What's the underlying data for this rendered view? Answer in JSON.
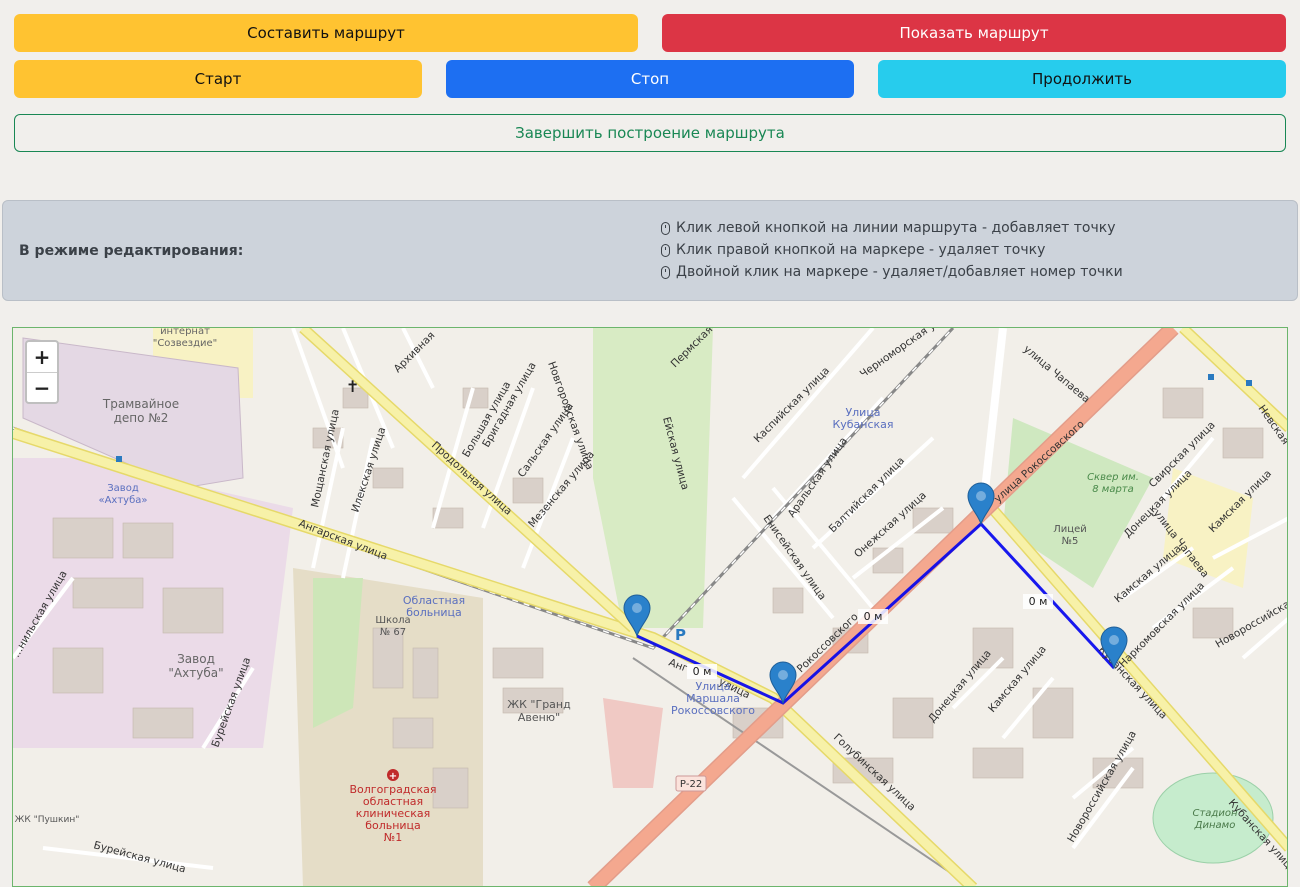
{
  "buttons": {
    "build_route": "Составить маршрут",
    "show_route": "Показать маршрут",
    "start": "Старт",
    "stop": "Стоп",
    "continue": "Продолжить",
    "finish": "Завершить построение маршрута"
  },
  "info": {
    "title": "В режиме редактирования:",
    "hints": [
      "Клик левой кнопкой на линии маршрута - добавляет точку",
      "Клик правой кнопкой на маркере - удаляет точку",
      "Двойной клик на маркере - удаляет/добавляет номер точки"
    ]
  },
  "map": {
    "zoom_in": "+",
    "zoom_out": "−",
    "route_color": "#0000ee",
    "segment_labels": [
      "0 м",
      "0 м",
      "0 м"
    ],
    "places": {
      "tram_depot": [
        "Трамвайное",
        "депо №2"
      ],
      "internat": [
        "интернат",
        "\"Созвездие\""
      ],
      "plant_akhtuba_top": [
        "Завод",
        "«Ахтуба»"
      ],
      "plant_akhtuba": [
        "Завод",
        "\"Ахтуба\""
      ],
      "regional_hospital": [
        "Областная",
        "больница"
      ],
      "school": [
        "Школа",
        "№ 67"
      ],
      "zhk_grand": [
        "ЖК \"Гранд",
        "Авеню\""
      ],
      "st_rokossovskogo": [
        "Улица",
        "Маршала",
        "Рокоссовского"
      ],
      "clinical_hospital": [
        "Волгоградская",
        "областная",
        "клиническая",
        "больница",
        "№1"
      ],
      "st_kubanskaya": [
        "Улица",
        "Кубанская"
      ],
      "skver": [
        "Сквер им.",
        "8 марта"
      ],
      "lyceum": [
        "Лицей",
        "№5"
      ],
      "stadium": [
        "Стадион",
        "Динамо"
      ],
      "zhk_pushkin": "ЖК \"Пушкин\"",
      "road_ref": "Р-22",
      "parking": "P"
    },
    "streets": {
      "angarskaya": "Ангарская улица",
      "angarskaya_short": "Анг",
      "ulitsa": "улица",
      "prodolnaya": "Продольная улица",
      "rokossovskogo_ne": "улица Рокоссовского",
      "rokossovskogo_sw": "Рокоссовского",
      "kubanskaya": "Кубанская улица",
      "kubanskaya_se": "Кубанская улица",
      "golubinskaya": "Голубинская улица",
      "mezenskaya": "Мезенская улица",
      "novgorodskaya": "Новгородская улица",
      "bolshaya": "Большая улица",
      "brigadnaya": "Бригадная улица",
      "salskaya": "Сальская улица",
      "ilekskaya": "Илекская улица",
      "moshchanskaya": "Мощанская улица",
      "eyskaya": "Ейская улица",
      "kaspiyskaya": "Каспийская улица",
      "aralskaya": "Аральская улица",
      "baltiyskaya": "Балтийская улица",
      "onezhskaya": "Онежская улица",
      "eniseyskaya": "Енисейская улица",
      "chernomorskaya": "Черноморская улица",
      "chapaeva": "улица Чапаева",
      "chapaeva2": "улица Чапаева",
      "svirskaya": "Свирская улица",
      "donetskaya": "Донецкая улица",
      "donetskaya2": "Донецкая улица",
      "kamskaya": "Камская улица",
      "kamskaya2": "Камская улица",
      "kamskaya3": "Камская улица",
      "narkomovskaya": "Наркомовская улица",
      "novorossiyskaya": "Новороссийская",
      "novorossiyskaya2": "Новороссийская улица",
      "nevskaya": "Невская",
      "permskaya": "Пермская",
      "bureyskaya": "Бурейская улица",
      "bureyskaya2": "Бурейская улица",
      "arkhivnaya": "Архивная",
      "khilskaya": "...нильская улица"
    }
  }
}
